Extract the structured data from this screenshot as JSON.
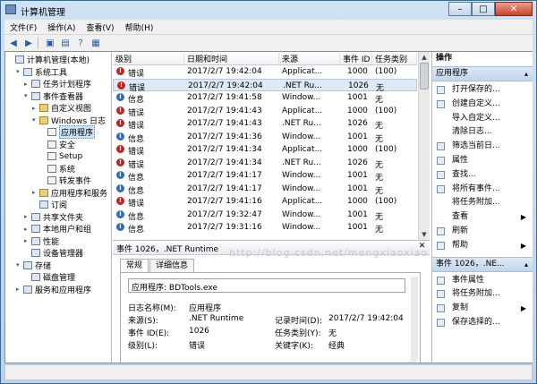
{
  "window": {
    "title": "计算机管理",
    "controls": [
      "–",
      "□",
      "✕"
    ]
  },
  "menu": [
    "文件(F)",
    "操作(A)",
    "查看(V)",
    "帮助(H)"
  ],
  "tree": [
    {
      "label": "计算机管理(本地)",
      "level": 0,
      "exp": "",
      "icon": "computer-icon"
    },
    {
      "label": "系统工具",
      "level": 1,
      "exp": "▾",
      "icon": "tools-icon"
    },
    {
      "label": "任务计划程序",
      "level": 2,
      "exp": "▸",
      "icon": "clock-icon"
    },
    {
      "label": "事件查看器",
      "level": 2,
      "exp": "▾",
      "icon": "event-viewer-icon"
    },
    {
      "label": "自定义视图",
      "level": 3,
      "exp": "▸",
      "icon": "folder-icon"
    },
    {
      "label": "Windows 日志",
      "level": 3,
      "exp": "▾",
      "icon": "folder-icon"
    },
    {
      "label": "应用程序",
      "level": 4,
      "exp": "",
      "icon": "log-icon",
      "selected": true
    },
    {
      "label": "安全",
      "level": 4,
      "exp": "",
      "icon": "log-icon"
    },
    {
      "label": "Setup",
      "level": 4,
      "exp": "",
      "icon": "log-icon"
    },
    {
      "label": "系统",
      "level": 4,
      "exp": "",
      "icon": "log-icon"
    },
    {
      "label": "转发事件",
      "level": 4,
      "exp": "",
      "icon": "log-icon"
    },
    {
      "label": "应用程序和服务",
      "level": 3,
      "exp": "▸",
      "icon": "folder-icon"
    },
    {
      "label": "订阅",
      "level": 3,
      "exp": "",
      "icon": "subscription-icon"
    },
    {
      "label": "共享文件夹",
      "level": 2,
      "exp": "▸",
      "icon": "shared-folder-icon"
    },
    {
      "label": "本地用户和组",
      "level": 2,
      "exp": "▸",
      "icon": "users-icon"
    },
    {
      "label": "性能",
      "level": 2,
      "exp": "▸",
      "icon": "performance-icon"
    },
    {
      "label": "设备管理器",
      "level": 2,
      "exp": "",
      "icon": "device-manager-icon"
    },
    {
      "label": "存储",
      "level": 1,
      "exp": "▾",
      "icon": "storage-icon"
    },
    {
      "label": "磁盘管理",
      "level": 2,
      "exp": "",
      "icon": "disk-icon"
    },
    {
      "label": "服务和应用程序",
      "level": 1,
      "exp": "▸",
      "icon": "services-icon"
    }
  ],
  "grid": {
    "headers": [
      "级别",
      "日期和时间",
      "来源",
      "事件 ID",
      "任务类别"
    ],
    "rows": [
      {
        "level": "错误",
        "type": "err",
        "time": "2017/2/7 19:42:04",
        "source": "Applicat...",
        "id": "1000",
        "cat": "(100)"
      },
      {
        "level": "错误",
        "type": "err",
        "time": "2017/2/7 19:42:04",
        "source": ".NET Ru...",
        "id": "1026",
        "cat": "无",
        "selected": true
      },
      {
        "level": "信息",
        "type": "info",
        "time": "2017/2/7 19:41:58",
        "source": "Window...",
        "id": "1001",
        "cat": "无"
      },
      {
        "level": "错误",
        "type": "err",
        "time": "2017/2/7 19:41:43",
        "source": "Applicat...",
        "id": "1000",
        "cat": "(100)"
      },
      {
        "level": "错误",
        "type": "err",
        "time": "2017/2/7 19:41:43",
        "source": ".NET Ru...",
        "id": "1026",
        "cat": "无"
      },
      {
        "level": "信息",
        "type": "info",
        "time": "2017/2/7 19:41:36",
        "source": "Window...",
        "id": "1001",
        "cat": "无"
      },
      {
        "level": "错误",
        "type": "err",
        "time": "2017/2/7 19:41:34",
        "source": "Applicat...",
        "id": "1000",
        "cat": "(100)"
      },
      {
        "level": "错误",
        "type": "err",
        "time": "2017/2/7 19:41:34",
        "source": ".NET Ru...",
        "id": "1026",
        "cat": "无"
      },
      {
        "level": "信息",
        "type": "info",
        "time": "2017/2/7 19:41:17",
        "source": "Window...",
        "id": "1001",
        "cat": "无"
      },
      {
        "level": "信息",
        "type": "info",
        "time": "2017/2/7 19:41:17",
        "source": "Window...",
        "id": "1001",
        "cat": "无"
      },
      {
        "level": "错误",
        "type": "err",
        "time": "2017/2/7 19:41:16",
        "source": "Applicat...",
        "id": "1000",
        "cat": "(100)"
      },
      {
        "level": "信息",
        "type": "info",
        "time": "2017/2/7 19:32:47",
        "source": "Window...",
        "id": "1001",
        "cat": "无"
      },
      {
        "level": "信息",
        "type": "info",
        "time": "2017/2/7 19:31:16",
        "source": "Window...",
        "id": "1001",
        "cat": "无"
      }
    ]
  },
  "detail": {
    "title": "事件 1026，.NET Runtime",
    "tabs": [
      "常规",
      "详细信息"
    ],
    "general_text": "应用程序: BDTools.exe",
    "props": {
      "log_name_label": "日志名称(M):",
      "log_name": "应用程序",
      "source_label": "来源(S):",
      "source": ".NET Runtime",
      "logged_label": "记录时间(D):",
      "logged": "2017/2/7 19:42:04",
      "event_id_label": "事件 ID(E):",
      "event_id": "1026",
      "task_label": "任务类别(Y):",
      "task": "无",
      "level_label": "级别(L):",
      "level": "错误",
      "keywords_label": "关键字(K):",
      "keywords": "经典"
    }
  },
  "actions": {
    "header": "操作",
    "section1": "应用程序",
    "items1": [
      {
        "label": "打开保存的...",
        "icon": "open-folder-icon"
      },
      {
        "label": "创建自定义...",
        "icon": "filter-icon"
      },
      {
        "label": "导入自定义...",
        "icon": ""
      },
      {
        "label": "清除日志...",
        "icon": ""
      },
      {
        "label": "筛选当前日...",
        "icon": "filter-icon"
      },
      {
        "label": "属性",
        "icon": "properties-icon"
      },
      {
        "label": "查找...",
        "icon": "binoculars-icon"
      },
      {
        "label": "将所有事件...",
        "icon": "save-icon"
      },
      {
        "label": "将任务附加...",
        "icon": ""
      },
      {
        "label": "查看",
        "icon": "",
        "submenu": true
      },
      {
        "label": "刷新",
        "icon": "refresh-icon"
      },
      {
        "label": "帮助",
        "icon": "help-icon",
        "submenu": true
      }
    ],
    "section2": "事件 1026，.NE...",
    "items2": [
      {
        "label": "事件属性",
        "icon": "event-properties-icon"
      },
      {
        "label": "将任务附加...",
        "icon": "task-icon"
      },
      {
        "label": "复制",
        "icon": "copy-icon",
        "submenu": true
      },
      {
        "label": "保存选择的...",
        "icon": "save-icon"
      }
    ]
  },
  "watermark": "http://blog.csdn.net/mengxiaoxiao"
}
